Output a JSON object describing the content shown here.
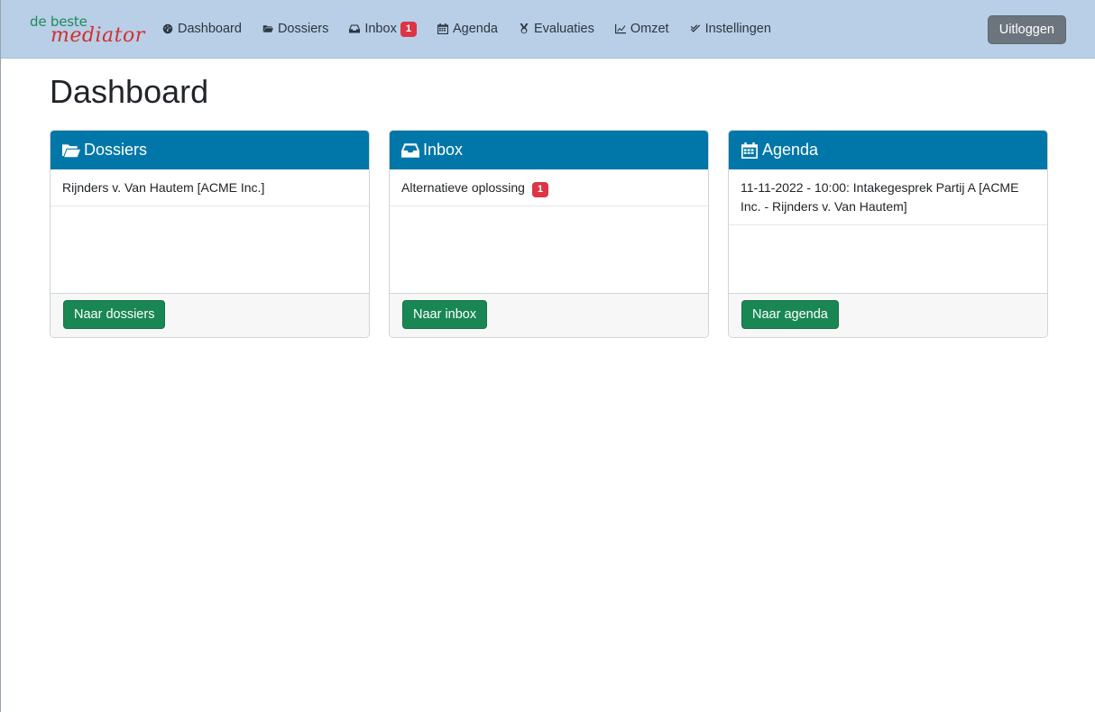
{
  "brand": {
    "top": "de beste",
    "bottom": "mediator"
  },
  "nav": {
    "dashboard": "Dashboard",
    "dossiers": "Dossiers",
    "inbox": "Inbox",
    "inbox_badge": "1",
    "agenda": "Agenda",
    "evaluaties": "Evaluaties",
    "omzet": "Omzet",
    "instellingen": "Instellingen"
  },
  "logout_label": "Uitloggen",
  "page_title": "Dashboard",
  "cards": {
    "dossiers": {
      "title": "Dossiers",
      "icon": "folder-open-icon",
      "items": [
        "Rijnders v. Van Hautem [ACME Inc.]"
      ],
      "button": "Naar dossiers"
    },
    "inbox": {
      "title": "Inbox",
      "icon": "inbox-icon",
      "items": [
        "Alternatieve oplossing"
      ],
      "item_badge": "1",
      "button": "Naar inbox"
    },
    "agenda": {
      "title": "Agenda",
      "icon": "calendar-icon",
      "items": [
        "11-11-2022 - 10:00: Intakegesprek Partij A [ACME Inc. - Rijnders v. Van Hautem]"
      ],
      "button": "Naar agenda"
    }
  },
  "colors": {
    "navbar_bg": "#b8cfe7",
    "card_header": "#0077a8",
    "primary_button": "#198754",
    "logout_button": "#6c757d",
    "badge": "#dc3545"
  }
}
